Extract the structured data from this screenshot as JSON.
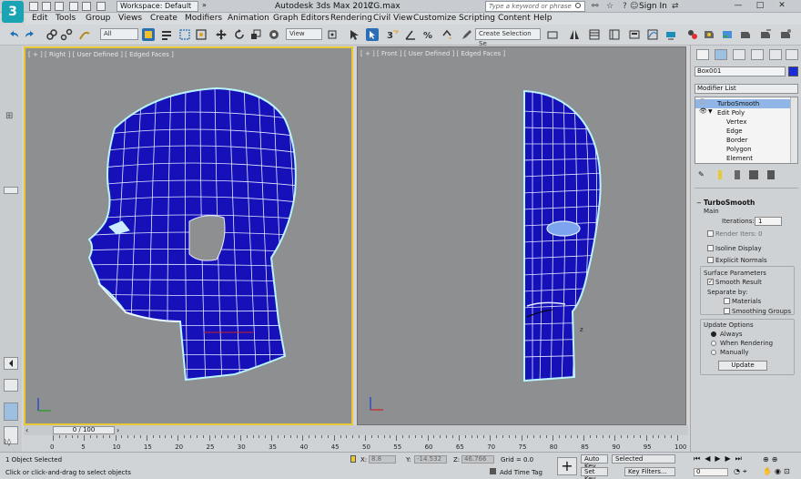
{
  "titlebar": {
    "logo": "3",
    "workspace": "Workspace: Default",
    "app_title": "Autodesk 3ds Max 2017",
    "file_name": "CG.max",
    "search_placeholder": "Type a keyword or phrase",
    "sign_in": "Sign In"
  },
  "menu": [
    "Edit",
    "Tools",
    "Group",
    "Views",
    "Create",
    "Modifiers",
    "Animation",
    "Graph Editors",
    "Rendering",
    "Civil View",
    "Customize",
    "Scripting",
    "Content",
    "Help"
  ],
  "toolbar": {
    "filter": "All",
    "ref_coord": "View",
    "selection_set": "Create Selection Se"
  },
  "viewports": {
    "right_label": "[ + ] [ Right ] [ User Defined ] [ Edged Faces ]",
    "front_label": "[ + ] [ Front ] [ User Defined ] [ Edged Faces ]"
  },
  "command_panel": {
    "object_name": "Box001",
    "object_color": "#1a2bd8",
    "modifier_list": "Modifier List",
    "stack": [
      {
        "label": "TurboSmooth",
        "selected": true
      },
      {
        "label": "Edit Poly",
        "selected": false
      },
      {
        "label": "Vertex",
        "sub": true
      },
      {
        "label": "Edge",
        "sub": true
      },
      {
        "label": "Border",
        "sub": true
      },
      {
        "label": "Polygon",
        "sub": true
      },
      {
        "label": "Element",
        "sub": true
      }
    ],
    "rollout_title": "TurboSmooth",
    "main_group": "Main",
    "iterations_label": "Iterations:",
    "iterations_value": "1",
    "render_iters_label": "Render Iters:",
    "render_iters_value": "0",
    "isoline_display": "Isoline Display",
    "explicit_normals": "Explicit Normals",
    "surface_params": "Surface Parameters",
    "smooth_result": "Smooth Result",
    "separate_by": "Separate by:",
    "materials": "Materials",
    "smoothing_groups": "Smoothing Groups",
    "update_options": "Update Options",
    "always": "Always",
    "when_rendering": "When Rendering",
    "manually": "Manually",
    "update_button": "Update"
  },
  "timeline": {
    "slider_label": "0 / 100",
    "ticks": [
      "0",
      "5",
      "10",
      "15",
      "20",
      "25",
      "30",
      "35",
      "40",
      "45",
      "50",
      "55",
      "60",
      "65",
      "70",
      "75",
      "80",
      "85",
      "90",
      "95",
      "100"
    ]
  },
  "status": {
    "selected": "1 Object Selected",
    "hint": "Click or click-and-drag to select objects",
    "x_label": "X:",
    "x_value": "8.8",
    "y_label": "Y:",
    "y_value": "-14.532",
    "z_label": "Z:",
    "z_value": "46.766",
    "grid": "Grid = 0.0",
    "add_time_tag": "Add Time Tag",
    "auto_key": "Auto Key",
    "set_key": "Set Key",
    "selected_dropdown": "Selected",
    "key_filters": "Key Filters...",
    "frame_value": "0"
  }
}
